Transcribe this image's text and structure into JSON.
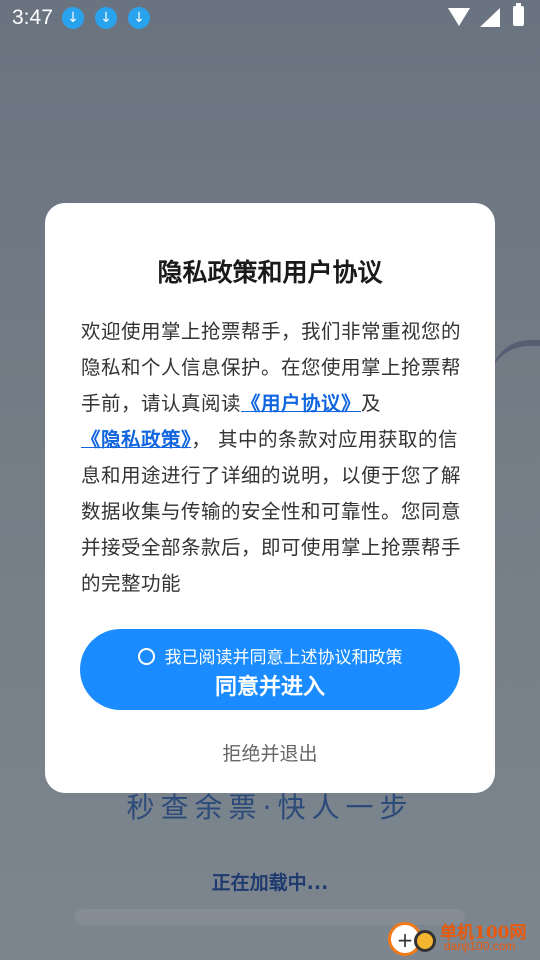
{
  "status_bar": {
    "time": "3:47",
    "download_icon_glyph": "↓"
  },
  "background": {
    "slogan": "秒查余票·快人一步",
    "loading_text": "正在加载中...",
    "progress_fraction": 0.0
  },
  "dialog": {
    "title": "隐私政策和用户协议",
    "body_part1": "欢迎使用掌上抢票帮手，我们非常重视您的隐私和个人信息保护。在您使用掌上抢票帮手前，请认真阅读",
    "link_user_agreement": "《用户协议》",
    "and": "及",
    "link_privacy_policy": "《隐私政策》",
    "body_part2": "， 其中的条款对应用获取的信息和用途进行了详细的说明，以便于您了解数据收集与传输的安全性和可靠性。您同意并接受全部条款后，即可使用掌上抢票帮手的完整功能",
    "agree_checkbox_label": "我已阅读并同意上述协议和政策",
    "agree_button": "同意并进入",
    "reject_button": "拒绝并退出"
  },
  "watermark": {
    "brand_cn": "单机100网",
    "brand_en": "danji100.com"
  },
  "colors": {
    "primary_button": "#1a8cff",
    "link": "#1166e0",
    "download_badge": "#2aa3ee",
    "watermark": "#e8590c"
  }
}
